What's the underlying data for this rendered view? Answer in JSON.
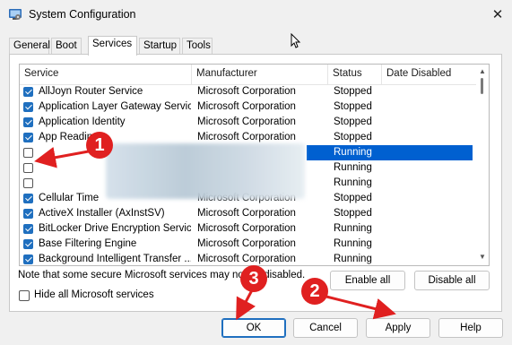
{
  "window": {
    "title": "System Configuration",
    "close_glyph": "✕"
  },
  "tabs": [
    {
      "label": "General"
    },
    {
      "label": "Boot"
    },
    {
      "label": "Services",
      "active": true
    },
    {
      "label": "Startup"
    },
    {
      "label": "Tools"
    }
  ],
  "columns": [
    "Service",
    "Manufacturer",
    "Status",
    "Date Disabled"
  ],
  "rows": [
    {
      "checked": true,
      "name": "AllJoyn Router Service",
      "manufacturer": "Microsoft Corporation",
      "status": "Stopped"
    },
    {
      "checked": true,
      "name": "Application Layer Gateway Service",
      "manufacturer": "Microsoft Corporation",
      "status": "Stopped"
    },
    {
      "checked": true,
      "name": "Application Identity",
      "manufacturer": "Microsoft Corporation",
      "status": "Stopped"
    },
    {
      "checked": true,
      "name": "App Readin",
      "manufacturer": "Microsoft Corporation",
      "status": "Stopped"
    },
    {
      "checked": false,
      "name": "",
      "manufacturer": "",
      "status": "Running",
      "selected": true
    },
    {
      "checked": false,
      "name": "",
      "manufacturer": "",
      "status": "Running"
    },
    {
      "checked": false,
      "name": "",
      "manufacturer": "",
      "status": "Running"
    },
    {
      "checked": true,
      "name": "Cellular Time",
      "manufacturer": "Microsoft Corporation",
      "status": "Stopped"
    },
    {
      "checked": true,
      "name": "ActiveX Installer (AxInstSV)",
      "manufacturer": "Microsoft Corporation",
      "status": "Stopped"
    },
    {
      "checked": true,
      "name": "BitLocker Drive Encryption Service",
      "manufacturer": "Microsoft Corporation",
      "status": "Running"
    },
    {
      "checked": true,
      "name": "Base Filtering Engine",
      "manufacturer": "Microsoft Corporation",
      "status": "Running"
    },
    {
      "checked": true,
      "name": "Background Intelligent Transfer ...",
      "manufacturer": "Microsoft Corporation",
      "status": "Running"
    }
  ],
  "note": "Note that some secure Microsoft services may not be disabled.",
  "buttons": {
    "enable_all": "Enable all",
    "disable_all": "Disable all",
    "hide_ms": "Hide all Microsoft services",
    "ok": "OK",
    "cancel": "Cancel",
    "apply": "Apply",
    "help": "Help"
  },
  "annotations": {
    "badge1": "1",
    "badge2": "2",
    "badge3": "3",
    "color": "#e02020"
  },
  "colors": {
    "accent": "#1f6fbf",
    "selection": "#0060d0"
  }
}
